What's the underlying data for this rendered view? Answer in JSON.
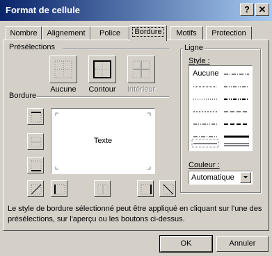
{
  "window": {
    "title": "Format de cellule",
    "help_btn": "?",
    "close_btn": "✕"
  },
  "tabs": [
    {
      "label": "Nombre"
    },
    {
      "label": "Alignement"
    },
    {
      "label": "Police"
    },
    {
      "label": "Bordure"
    },
    {
      "label": "Motifs"
    },
    {
      "label": "Protection"
    }
  ],
  "presets": {
    "heading": "Présélections",
    "items": [
      {
        "label": "Aucune"
      },
      {
        "label": "Contour"
      },
      {
        "label": "Intérieur"
      }
    ]
  },
  "border": {
    "heading": "Bordure",
    "preview_text": "Texte"
  },
  "line": {
    "heading": "Ligne",
    "style_label": "Style :",
    "none_label": "Aucune",
    "color_label": "Couleur :",
    "color_value": "Automatique"
  },
  "info": "Le style de bordure sélectionné peut être appliqué en cliquant sur l'une des présélections, sur l'aperçu ou les boutons ci-dessus.",
  "buttons": {
    "ok": "OK",
    "cancel": "Annuler"
  },
  "colors": {
    "title_start": "#0a246a",
    "title_end": "#a6caf0",
    "face": "#d4d0c8"
  }
}
